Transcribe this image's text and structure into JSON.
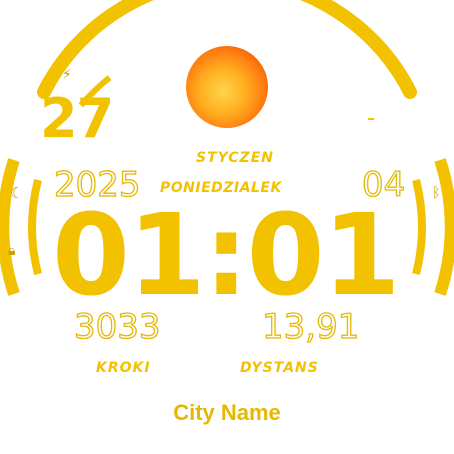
{
  "date": {
    "day": "27",
    "month": "STYCZEN",
    "year": "2025",
    "weekday": "PONIEDZIALEK",
    "week_number": "04"
  },
  "time": {
    "display": "01:01"
  },
  "activity": {
    "steps_value": "3033",
    "steps_label": "KROKI",
    "distance_value": "13,91",
    "distance_label": "DYSTANS"
  },
  "location": {
    "city": "City Name"
  },
  "battery": {
    "level": 0.12
  },
  "icons": {
    "charging": "lightning-icon",
    "weather": "sun-icon",
    "night": "moon-icon",
    "lock": "lock-icon",
    "connection": "bluetooth-icon"
  },
  "colors": {
    "accent": "#f2c200",
    "accent_dark": "#e6b800",
    "background": "#ffffff"
  }
}
